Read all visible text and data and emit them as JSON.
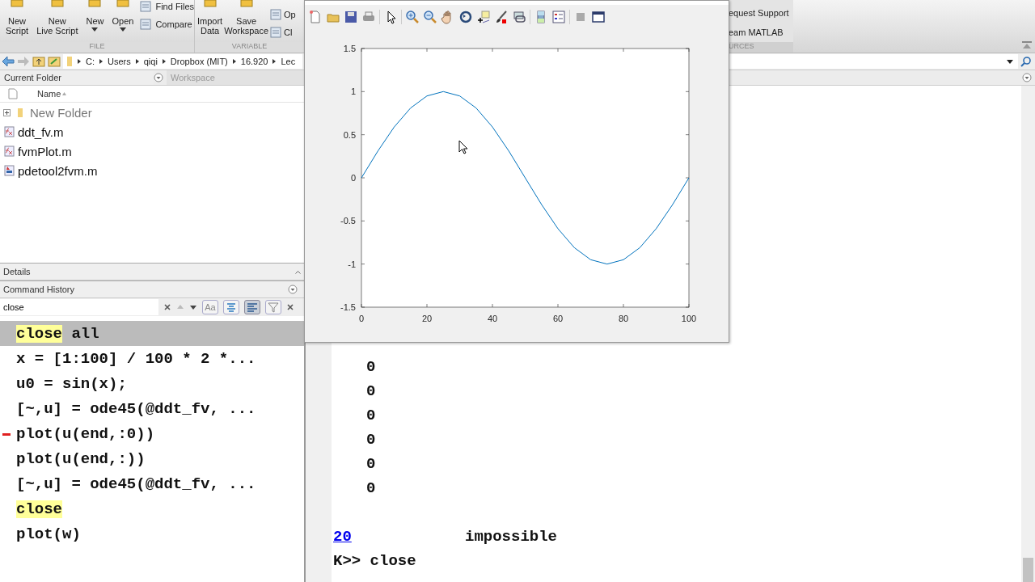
{
  "toolstrip": {
    "sections": [
      {
        "label": "FILE",
        "large": [
          {
            "lines": [
              "New",
              "Script"
            ],
            "caret": false
          },
          {
            "lines": [
              "New",
              "Live Script"
            ],
            "caret": false
          },
          {
            "lines": [
              "New"
            ],
            "caret": true
          },
          {
            "lines": [
              "Open"
            ],
            "caret": true
          }
        ],
        "small": [
          "Find Files",
          "Compare"
        ]
      },
      {
        "label": "VARIABLE",
        "large": [
          {
            "lines": [
              "Import",
              "Data"
            ],
            "caret": false
          },
          {
            "lines": [
              "Save",
              "Workspace"
            ],
            "caret": false
          }
        ],
        "small": [
          "Op",
          "Cl"
        ]
      }
    ],
    "right_section": {
      "items": [
        "equest Support",
        "eam MATLAB"
      ],
      "label": "URCES"
    }
  },
  "address_bar": {
    "path": [
      "C:",
      "Users",
      "qiqi",
      "Dropbox (MIT)",
      "16.920",
      "Lec"
    ]
  },
  "current_folder": {
    "tabs": [
      {
        "label": "Current Folder",
        "selected": true
      },
      {
        "label": "Workspace",
        "selected": false
      }
    ],
    "column": "Name",
    "items": [
      {
        "kind": "folder",
        "name": "New Folder"
      },
      {
        "kind": "function",
        "name": "ddt_fv.m"
      },
      {
        "kind": "function",
        "name": "fvmPlot.m"
      },
      {
        "kind": "script",
        "name": "pdetool2fvm.m"
      }
    ]
  },
  "details": {
    "label": "Details"
  },
  "command_history": {
    "title": "Command History",
    "search": {
      "value": "close"
    },
    "toggles": [
      {
        "kind": "text",
        "label": "Aa",
        "selected": false
      },
      {
        "kind": "align-center",
        "selected": false
      },
      {
        "kind": "align-left",
        "selected": true
      },
      {
        "kind": "filter",
        "selected": false
      }
    ],
    "lines": [
      {
        "selected": true,
        "marker": false,
        "parts": [
          {
            "text": "close",
            "highlighted": true
          },
          {
            "text": " all",
            "highlighted": false
          }
        ]
      },
      {
        "selected": false,
        "marker": false,
        "parts": [
          {
            "text": "x = [1:100] / 100 * 2 *...",
            "highlighted": false
          }
        ]
      },
      {
        "selected": false,
        "marker": false,
        "parts": [
          {
            "text": "u0 = sin(x);",
            "highlighted": false
          }
        ]
      },
      {
        "selected": false,
        "marker": false,
        "parts": [
          {
            "text": "[~,u] = ode45(@ddt_fv, ...",
            "highlighted": false
          }
        ]
      },
      {
        "selected": false,
        "marker": true,
        "parts": [
          {
            "text": "plot(u(end,:0))",
            "highlighted": false
          }
        ]
      },
      {
        "selected": false,
        "marker": false,
        "parts": [
          {
            "text": "plot(u(end,:))",
            "highlighted": false
          }
        ]
      },
      {
        "selected": false,
        "marker": false,
        "parts": [
          {
            "text": "[~,u] = ode45(@ddt_fv, ...",
            "highlighted": false
          }
        ]
      },
      {
        "selected": false,
        "marker": false,
        "parts": [
          {
            "text": "close",
            "highlighted": true
          }
        ]
      },
      {
        "selected": false,
        "marker": false,
        "parts": [
          {
            "text": "plot(w)",
            "highlighted": false
          }
        ]
      }
    ]
  },
  "command_window": {
    "lines": [
      {
        "kind": "output",
        "text": "0"
      },
      {
        "kind": "output",
        "text": "0"
      },
      {
        "kind": "output",
        "text": "0"
      },
      {
        "kind": "output",
        "text": "0"
      },
      {
        "kind": "output",
        "text": "0"
      },
      {
        "kind": "output",
        "text": "0"
      },
      {
        "kind": "blank"
      },
      {
        "kind": "link",
        "link": "20",
        "text": "impossible"
      },
      {
        "kind": "prompt",
        "text": "K>> close"
      }
    ]
  },
  "figure": {
    "chart_data": {
      "type": "line",
      "x": [
        0,
        5,
        10,
        15,
        20,
        25,
        30,
        35,
        40,
        45,
        50,
        55,
        60,
        65,
        70,
        75,
        80,
        85,
        90,
        95,
        100
      ],
      "series": [
        {
          "color": "#0072bd",
          "values": [
            0,
            0.31,
            0.59,
            0.81,
            0.95,
            1,
            0.95,
            0.81,
            0.59,
            0.31,
            0,
            -0.31,
            -0.59,
            -0.81,
            -0.95,
            -1,
            -0.95,
            -0.81,
            -0.59,
            -0.31,
            0
          ]
        }
      ],
      "xlim": [
        0,
        100
      ],
      "ylim": [
        -1.5,
        1.5
      ],
      "xticks": [
        0,
        20,
        40,
        60,
        80,
        100
      ],
      "yticks": [
        {
          "value": -1.5,
          "label": "-1.5"
        },
        {
          "value": -1,
          "label": "-1"
        },
        {
          "value": -0.5,
          "label": "-0.5"
        },
        {
          "value": 0,
          "label": "0"
        },
        {
          "value": 0.5,
          "label": "0.5"
        },
        {
          "value": 1,
          "label": "1"
        },
        {
          "value": 1.5,
          "label": "1.5"
        }
      ]
    }
  }
}
